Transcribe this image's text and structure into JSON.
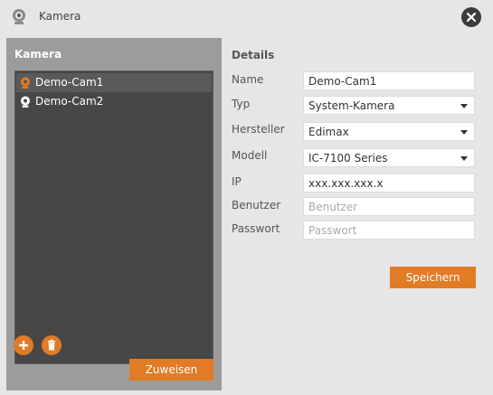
{
  "window": {
    "title": "Kamera",
    "icon": "webcam-icon",
    "close_icon": "close-icon"
  },
  "left_panel": {
    "title": "Kamera",
    "cameras": [
      {
        "label": "Demo-Cam1",
        "icon": "webcam-icon",
        "icon_color": "#e27b25",
        "selected": true
      },
      {
        "label": "Demo-Cam2",
        "icon": "webcam-icon",
        "icon_color": "#ffffff",
        "selected": false
      }
    ],
    "add_icon": "plus-icon",
    "delete_icon": "trash-icon",
    "assign_button": "Zuweisen"
  },
  "details": {
    "title": "Details",
    "fields": {
      "name": {
        "label": "Name",
        "value": "Demo-Cam1"
      },
      "typ": {
        "label": "Typ",
        "value": "System-Kamera"
      },
      "hersteller": {
        "label": "Hersteller",
        "value": "Edimax"
      },
      "modell": {
        "label": "Modell",
        "value": "IC-7100 Series"
      },
      "ip": {
        "label": "IP",
        "value": "xxx.xxx.xxx.x"
      },
      "benutzer": {
        "label": "Benutzer",
        "placeholder": "Benutzer"
      },
      "passwort": {
        "label": "Passwort",
        "placeholder": "Passwort"
      }
    },
    "save_button": "Speichern"
  },
  "colors": {
    "accent": "#e27b25",
    "panel": "#9c9c9c",
    "list_bg": "#474747",
    "background": "#e6e6e6"
  }
}
